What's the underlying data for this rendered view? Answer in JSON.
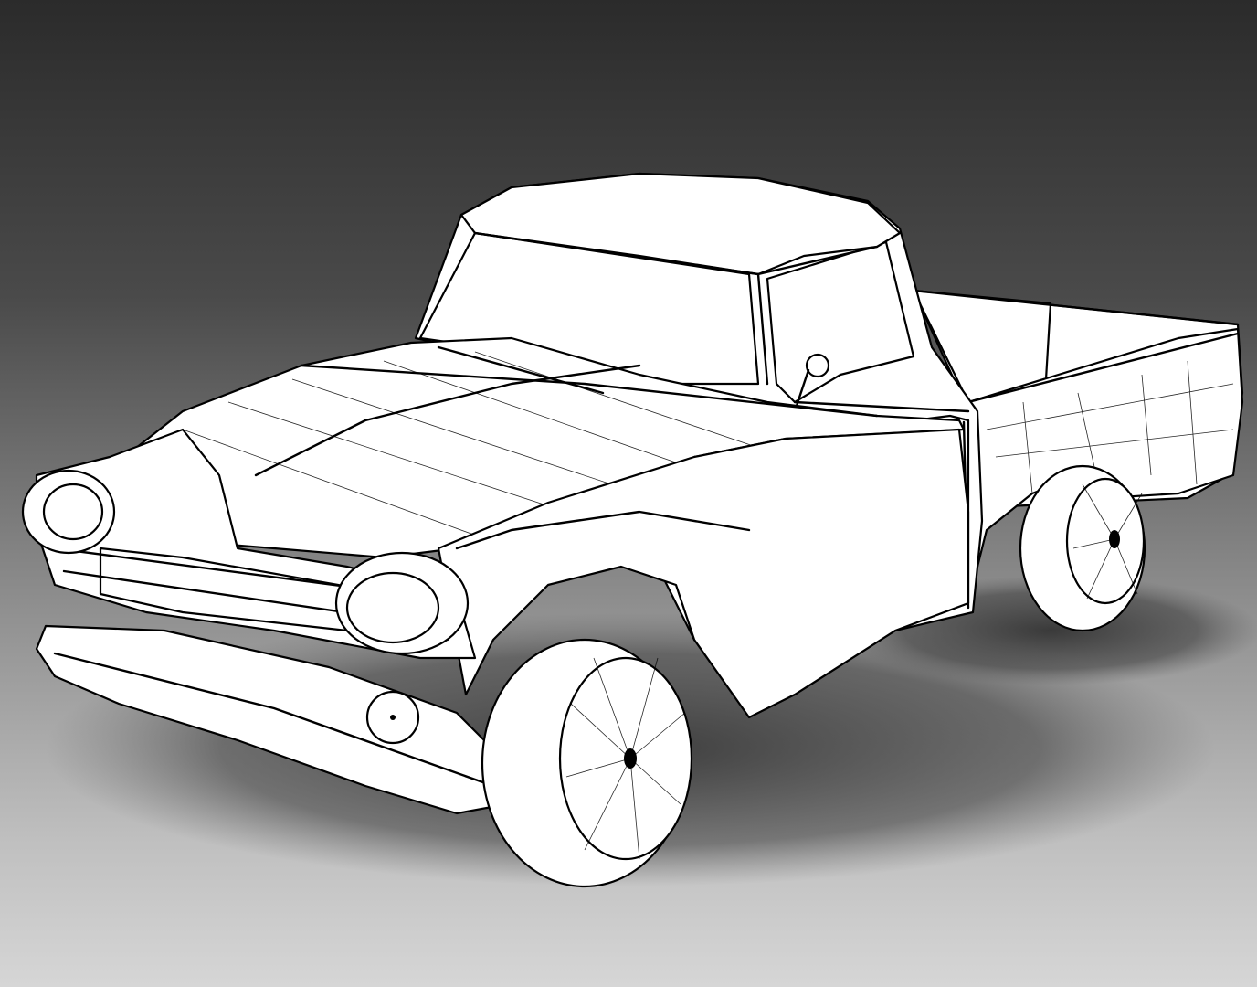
{
  "scene": {
    "subject": "pickup-truck",
    "render_mode": "wireframe",
    "colors": {
      "background_top": "#2b2b2b",
      "background_bottom": "#d6d6d6",
      "mesh_fill": "#ffffff",
      "mesh_lines": "#000000",
      "shadow": "#3a3a3a"
    }
  }
}
